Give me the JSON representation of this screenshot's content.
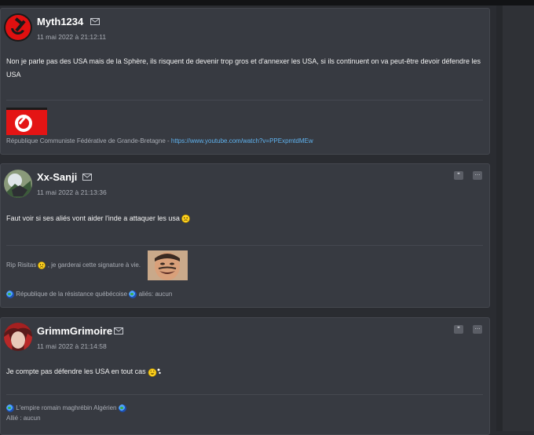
{
  "posts": [
    {
      "username": "Myth1234",
      "timestamp": "11 mai 2022 à 21:12:11",
      "body": "Non je parle pas des USA mais de la Sphère, ils risquent de devenir trop gros et d'annexer les USA, si ils continuent on va peut-être devoir défendre les USA",
      "signature_text": "République Communiste Fédérative de Grande-Bretagne - ",
      "signature_link": "https://www.youtube.com/watch?v=PPExpmtdMEw"
    },
    {
      "username": "Xx-Sanji",
      "timestamp": "11 mai 2022 à 21:13:36",
      "body": "Faut voir si ses aliés vont aider l'inde a attaquer les usa",
      "sig_rip": "Rip Risitas",
      "sig_rip_tail": ", je garderai cette signature à vie.",
      "sig_nation": "République de la résistance québécoise",
      "sig_allies": "aliés: aucun",
      "quote_btn": "❞",
      "more_btn": "⋯"
    },
    {
      "username": "GrimmGrimoire",
      "timestamp": "11 mai 2022 à 21:14:58",
      "body": "Je compte pas défendre les USA en tout cas",
      "sig_nation": "L'empire romain maghrébin Algérien",
      "sig_allies": "Allié : aucun",
      "quote_btn": "❞",
      "more_btn": "⋯"
    }
  ],
  "colors": {
    "background": "#2a2c31",
    "post_background": "#373a41",
    "link": "#5fb3f0",
    "muted_text": "#a9adb5"
  }
}
